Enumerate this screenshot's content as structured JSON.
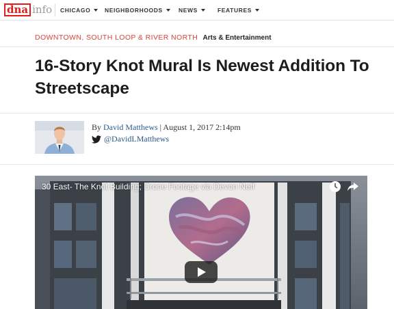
{
  "header": {
    "logo_dna": "dna",
    "logo_info": "info",
    "nav": [
      {
        "label": "CHICAGO"
      },
      {
        "label": "NEIGHBORHOODS"
      },
      {
        "label": "NEWS"
      },
      {
        "label": "FEATURES"
      }
    ]
  },
  "article": {
    "section_location": "DOWNTOWN, SOUTH LOOP & RIVER NORTH",
    "section_category": "Arts & Entertainment",
    "title": "16-Story Knot Mural Is Newest Addition To Streetscape",
    "byline_prefix": "By",
    "author": "David Matthews",
    "date_sep": "|",
    "date": "August 1, 2017 2:14pm",
    "twitter_handle": "@DavidLMatthews"
  },
  "video": {
    "title": "30 East- The Knot Building; Drone Footage via Devon Neff",
    "icons": [
      "clock-icon",
      "share-icon",
      "play-icon"
    ]
  },
  "colors": {
    "brand_red": "#e21b1b",
    "section_red": "#d8453a",
    "link_blue": "#2a5a8c"
  }
}
